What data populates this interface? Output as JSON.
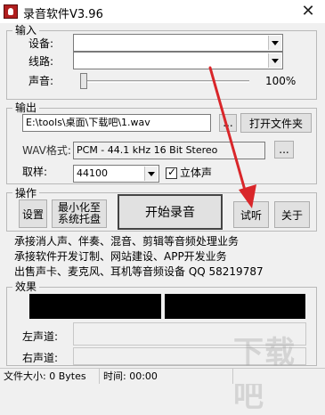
{
  "window": {
    "title": "录音软件V3.96",
    "close_symbol": "✕"
  },
  "input_group": {
    "title": "输入",
    "device_label": "设备:",
    "device_value": "",
    "line_label": "线路:",
    "line_value": "",
    "volume_label": "声音:",
    "volume_value": "100%",
    "volume_level": 0.0
  },
  "output_group": {
    "title": "输出",
    "path_value": "E:\\tools\\桌面\\下载吧\\1.wav",
    "browse_label": "...",
    "open_folder_label": "打开文件夹",
    "wav_label": "WAV格式:",
    "wav_value": "PCM - 44.1 kHz 16 Bit Stereo",
    "wav_browse_label": "...",
    "sample_label": "取样:",
    "sample_value": "44100",
    "stereo_label": "立体声",
    "stereo_checked": true
  },
  "operation_group": {
    "title": "操作",
    "settings_label": "设置",
    "minimize_label_1": "最小化至",
    "minimize_label_2": "系统托盘",
    "record_label": "开始录音",
    "listen_label": "试听",
    "about_label": "关于"
  },
  "info_lines": [
    "承接消人声、伴奏、混音、剪辑等音频处理业务",
    "承接软件开发订制、网站建设、APP开发业务",
    "出售声卡、麦克风、耳机等音频设备 QQ 58219787"
  ],
  "effects_group": {
    "title": "效果",
    "left_label": "左声道:",
    "right_label": "右声道:"
  },
  "status": {
    "file_size": "文件大小: 0 Bytes",
    "time": "时间: 00:00"
  },
  "colors": {
    "arrow": "#d9262a",
    "meter": "#000000"
  }
}
